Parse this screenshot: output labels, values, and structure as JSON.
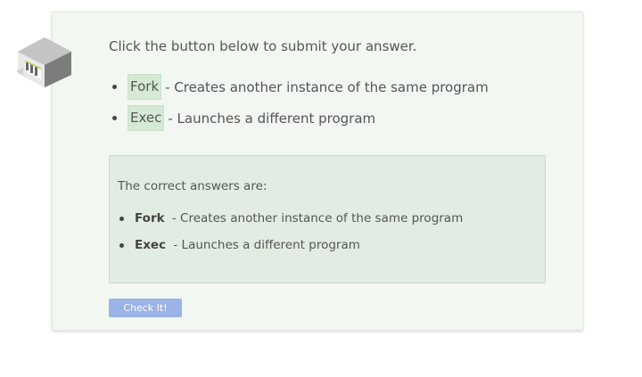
{
  "prompt": "Click the button below to submit your answer.",
  "options": [
    {
      "term": "Fork",
      "definition": "- Creates another instance of the same program"
    },
    {
      "term": "Exec",
      "definition": "- Launches a different program"
    }
  ],
  "answers": {
    "title": "The correct answers are:",
    "items": [
      {
        "term": "Fork",
        "definition": "- Creates another instance of the same program"
      },
      {
        "term": "Exec",
        "definition": "- Launches a different program"
      }
    ]
  },
  "button": {
    "label": "Check It!"
  },
  "colors": {
    "card_bg": "#f2f7f2",
    "chip_bg": "#d4ead5",
    "answers_bg": "#e2ece2",
    "button_bg": "#9bb3e6"
  },
  "icons": {
    "logo": "isometric-building-logo"
  }
}
